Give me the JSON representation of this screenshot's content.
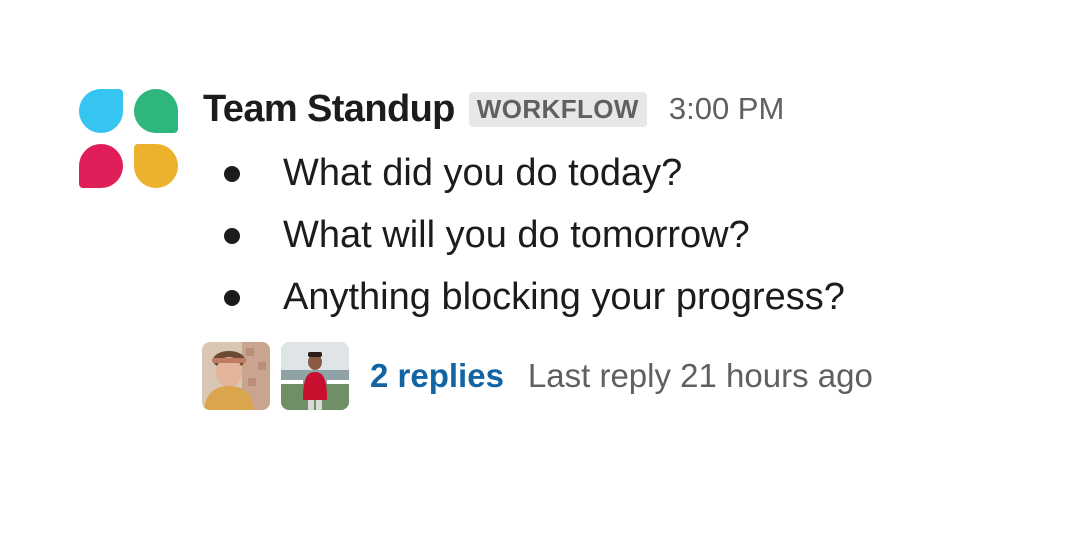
{
  "app_icon": {
    "name": "workflow-app-icon",
    "colors": {
      "blue": "#36c5f0",
      "green": "#2eb67d",
      "red": "#e01e5a",
      "yellow": "#ecb22e"
    }
  },
  "message": {
    "sender": "Team Standup",
    "badge": "WORKFLOW",
    "time": "3:00 PM",
    "bullets": [
      "What did you do today?",
      "What will you do tomorrow?",
      "Anything blocking your progress?"
    ]
  },
  "thread": {
    "avatars": [
      {
        "name": "avatar-woman-icon"
      },
      {
        "name": "avatar-man-icon"
      }
    ],
    "replies_label": "2 replies",
    "last_reply": "Last reply 21 hours ago"
  },
  "colors": {
    "link": "#1264a3",
    "muted": "#616061",
    "text": "#1d1c1d"
  }
}
